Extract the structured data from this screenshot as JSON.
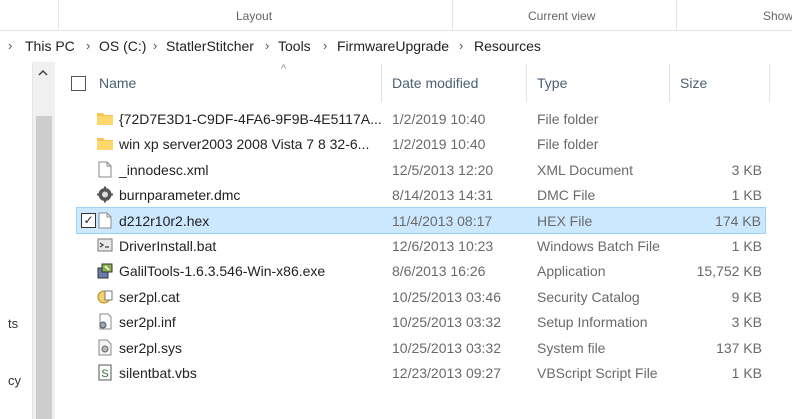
{
  "ribbon": {
    "layout_label": "Layout",
    "current_view_label": "Current view",
    "show_label": "Show"
  },
  "breadcrumb": {
    "items": [
      "This PC",
      "OS (C:)",
      "StatlerStitcher",
      "Tools",
      "FirmwareUpgrade",
      "Resources"
    ],
    "separator": "›",
    "lead": "›"
  },
  "navpane": {
    "partial_items": [
      "ts",
      "cy"
    ]
  },
  "columns": {
    "name": "Name",
    "date": "Date modified",
    "type": "Type",
    "size": "Size",
    "sort_indicator": "^"
  },
  "files": [
    {
      "name": "{72D7E3D1-C9DF-4FA6-9F9B-4E5117A...",
      "date": "1/2/2019 10:40",
      "type": "File folder",
      "size": "",
      "icon": "folder-icon"
    },
    {
      "name": "win xp server2003 2008 Vista 7 8 32-6...",
      "date": "1/2/2019 10:40",
      "type": "File folder",
      "size": "",
      "icon": "folder-icon"
    },
    {
      "name": "_innodesc.xml",
      "date": "12/5/2013 12:20",
      "type": "XML Document",
      "size": "3 KB",
      "icon": "document-icon"
    },
    {
      "name": "burnparameter.dmc",
      "date": "8/14/2013 14:31",
      "type": "DMC File",
      "size": "1 KB",
      "icon": "gear-file-icon"
    },
    {
      "name": "d212r10r2.hex",
      "date": "11/4/2013 08:17",
      "type": "HEX File",
      "size": "174 KB",
      "icon": "document-icon",
      "selected": true,
      "check": "✓"
    },
    {
      "name": "DriverInstall.bat",
      "date": "12/6/2013 10:23",
      "type": "Windows Batch File",
      "size": "1 KB",
      "icon": "batch-file-icon"
    },
    {
      "name": "GalilTools-1.6.3.546-Win-x86.exe",
      "date": "8/6/2013 16:26",
      "type": "Application",
      "size": "15,752 KB",
      "icon": "installer-icon"
    },
    {
      "name": "ser2pl.cat",
      "date": "10/25/2013 03:46",
      "type": "Security Catalog",
      "size": "9 KB",
      "icon": "security-catalog-icon"
    },
    {
      "name": "ser2pl.inf",
      "date": "10/25/2013 03:32",
      "type": "Setup Information",
      "size": "3 KB",
      "icon": "setup-info-icon"
    },
    {
      "name": "ser2pl.sys",
      "date": "10/25/2013 03:32",
      "type": "System file",
      "size": "137 KB",
      "icon": "system-file-icon"
    },
    {
      "name": "silentbat.vbs",
      "date": "12/23/2013 09:27",
      "type": "VBScript Script File",
      "size": "1 KB",
      "icon": "vbscript-file-icon"
    }
  ],
  "colors": {
    "selection_bg": "#cce8ff",
    "selection_border": "#99d1ff",
    "folder": "#f8c44f",
    "header_text": "#4c6072"
  }
}
